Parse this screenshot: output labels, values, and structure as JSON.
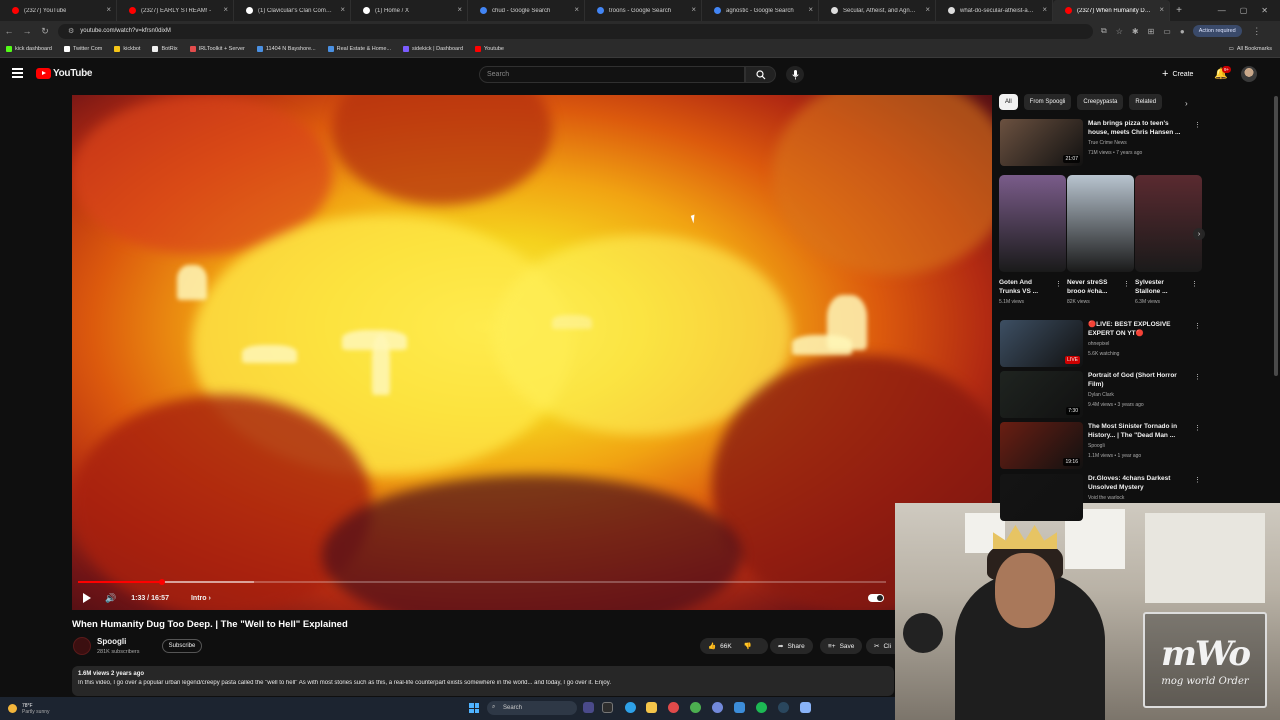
{
  "browser": {
    "tabs": [
      {
        "title": "(2327) YouTube",
        "color": "#ff0000"
      },
      {
        "title": "(2327) EARLY STREAM! -",
        "color": "#ff0000"
      },
      {
        "title": "(1) Clavicular's Clan Communi",
        "color": "#ffffff"
      },
      {
        "title": "(1) Home / X",
        "color": "#ffffff"
      },
      {
        "title": "chud - Google Search",
        "color": "#4285f4"
      },
      {
        "title": "troons - Google Search",
        "color": "#4285f4"
      },
      {
        "title": "agnostic - Google Search",
        "color": "#4285f4"
      },
      {
        "title": "Secular, Atheist, and Agnostic",
        "color": "#dddddd"
      },
      {
        "title": "what-do-secular-atheist-agno",
        "color": "#dddddd"
      },
      {
        "title": "(2327) When Humanity Dug T",
        "color": "#ff0000",
        "active": true
      }
    ],
    "url": "youtube.com/watch?v=kfrsn0dixM",
    "action_required": "Action required",
    "bookmarks": [
      {
        "label": "kick dashboard",
        "color": "#53fc18"
      },
      {
        "label": "Twitter Com",
        "color": "#ffffff"
      },
      {
        "label": "kickbot",
        "color": "#f5c518"
      },
      {
        "label": "BotRix",
        "color": "#f0f0f0"
      },
      {
        "label": "IRLToolkit + Server",
        "color": "#e34c4c"
      },
      {
        "label": "11404 N Bayshore...",
        "color": "#4a90e2"
      },
      {
        "label": "Real Estate & Home...",
        "color": "#4a90e2"
      },
      {
        "label": "sidekick | Dashboard",
        "color": "#7b5cff"
      },
      {
        "label": "Youtube",
        "color": "#ff0000"
      }
    ],
    "all_bookmarks": "All Bookmarks"
  },
  "youtube": {
    "logo_text": "YouTube",
    "search_placeholder": "Search",
    "create_label": "Create",
    "notif_badge": "9+"
  },
  "player": {
    "time": "1:33 / 16:57",
    "chapter": "Intro",
    "played_fraction": 0.104,
    "loaded_fraction": 0.218
  },
  "video": {
    "title": "When Humanity Dug Too Deep. | The \"Well to Hell\" Explained",
    "channel": "Spoogli",
    "subscribers": "281K subscribers",
    "subscribe_label": "Subscribe",
    "likes": "66K",
    "share_label": "Share",
    "save_label": "Save",
    "clip_label": "Cli",
    "meta": "1.6M views  2 years ago",
    "description": "In this video, I go over a popular urban legend/creepy pasta called the \"well to hell\" As with most stories such as this, a real-life counterpart exists somewhere in the world... and today, I go over it. Enjoy."
  },
  "sidebar": {
    "chips": [
      {
        "label": "All",
        "selected": true
      },
      {
        "label": "From Spoogli"
      },
      {
        "label": "Creepypasta"
      },
      {
        "label": "Related"
      }
    ],
    "recs": [
      {
        "title": "Man brings pizza to teen's house, meets Chris Hansen ...",
        "channel": "True Crime News",
        "stats": "71M views • 7 years ago",
        "duration": "21:07",
        "color": "#6b5140"
      },
      {
        "title": "🔴LIVE: BEST EXPLOSIVE EXPERT ON YT🔴",
        "channel": "ohnepixel",
        "stats": "5.6K watching",
        "duration": "LIVE",
        "color": "#3d4f63"
      },
      {
        "title": "Portrait of God (Short Horror Film)",
        "channel": "Dylan Clark",
        "stats": "9.4M views • 3 years ago",
        "duration": "7:30",
        "color": "#1f2420"
      },
      {
        "title": "The Most Sinister Tornado in History... | The \"Dead Man ...",
        "channel": "Spoogli",
        "stats": "1.1M views • 1 year ago",
        "duration": "19:16",
        "color": "#6a1e12"
      },
      {
        "title": "Dr.Gloves: 4chans Darkest Unsolved Mystery",
        "channel": "Void the warlock",
        "stats": "",
        "duration": "",
        "color": "#141414"
      }
    ],
    "shorts": [
      {
        "title": "Goten And Trunks VS ...",
        "views": "5.1M views",
        "color": "#7a5c8a"
      },
      {
        "title": "Never streSS brooo #cha...",
        "views": "82K views",
        "color": "#b8c4cf"
      },
      {
        "title": "Sylvester Stallone ...",
        "views": "6.3M views",
        "color": "#5a2a30"
      }
    ]
  },
  "overlay": {
    "watermark_big": "mWo",
    "watermark_small": "mog world Order"
  },
  "taskbar": {
    "temp": "78°F",
    "weather": "Partly sunny",
    "search": "Search"
  }
}
